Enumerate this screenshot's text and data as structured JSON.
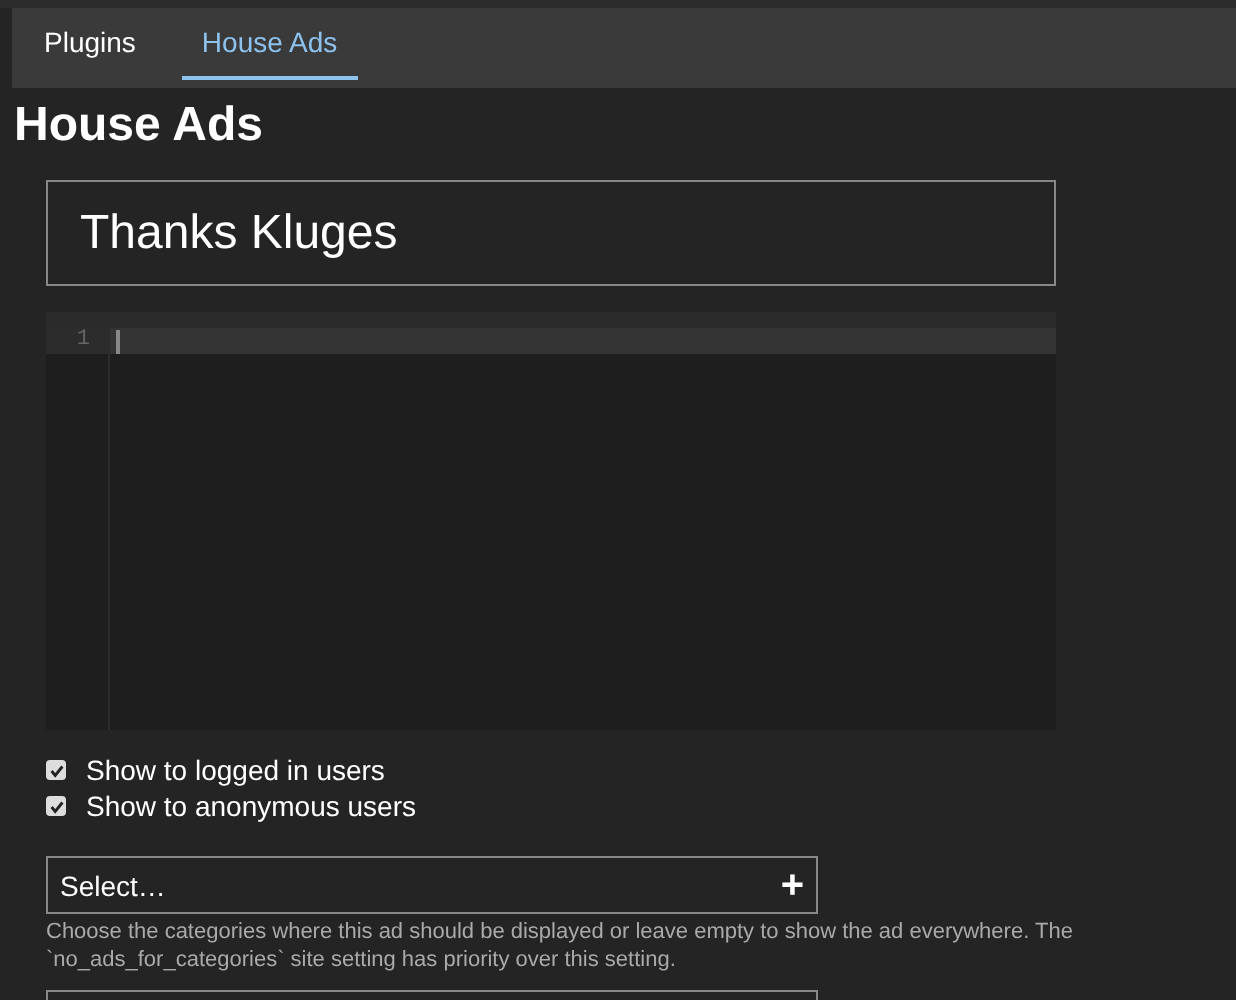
{
  "tabs": [
    {
      "label": "Plugins",
      "selected": false
    },
    {
      "label": "House Ads",
      "selected": true
    }
  ],
  "title": "House Ads",
  "name_field": {
    "value": "Thanks Kluges"
  },
  "editor": {
    "line_numbers": [
      "1"
    ]
  },
  "options": [
    {
      "label": "Show to logged in users",
      "checked": true
    },
    {
      "label": "Show to anonymous users",
      "checked": true
    }
  ],
  "category_select": {
    "placeholder": "Select…",
    "add_symbol": "+"
  },
  "help_text": "Choose the categories where this ad should be displayed or leave empty to show the ad everywhere. The `no_ads_for_categories` site setting has priority over this setting."
}
